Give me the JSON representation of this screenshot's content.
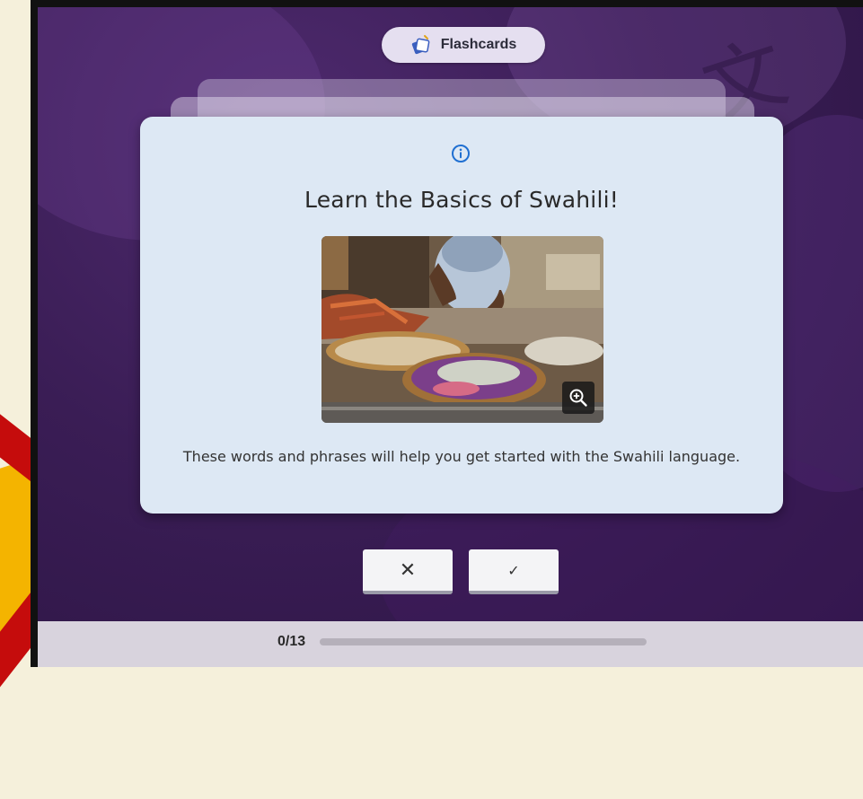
{
  "header": {
    "badge_label": "Flashcards",
    "badge_icon": "flashcard-deck-icon"
  },
  "card": {
    "info_icon": "info-icon",
    "title": "Learn the Basics of Swahili!",
    "image_alt": "Market vendor with seafood baskets",
    "zoom_icon": "zoom-in-icon",
    "description": "These words and phrases will help you get started with the Swahili language."
  },
  "actions": {
    "reject_label": "✕",
    "accept_label": "✓"
  },
  "progress": {
    "label": "0/13",
    "current": 0,
    "total": 13
  },
  "colors": {
    "background": "#3a1d55",
    "card": "#dde8f4",
    "accent_info": "#1f6fd1",
    "decor_red": "#c50c0c",
    "decor_yellow": "#f4b400"
  }
}
